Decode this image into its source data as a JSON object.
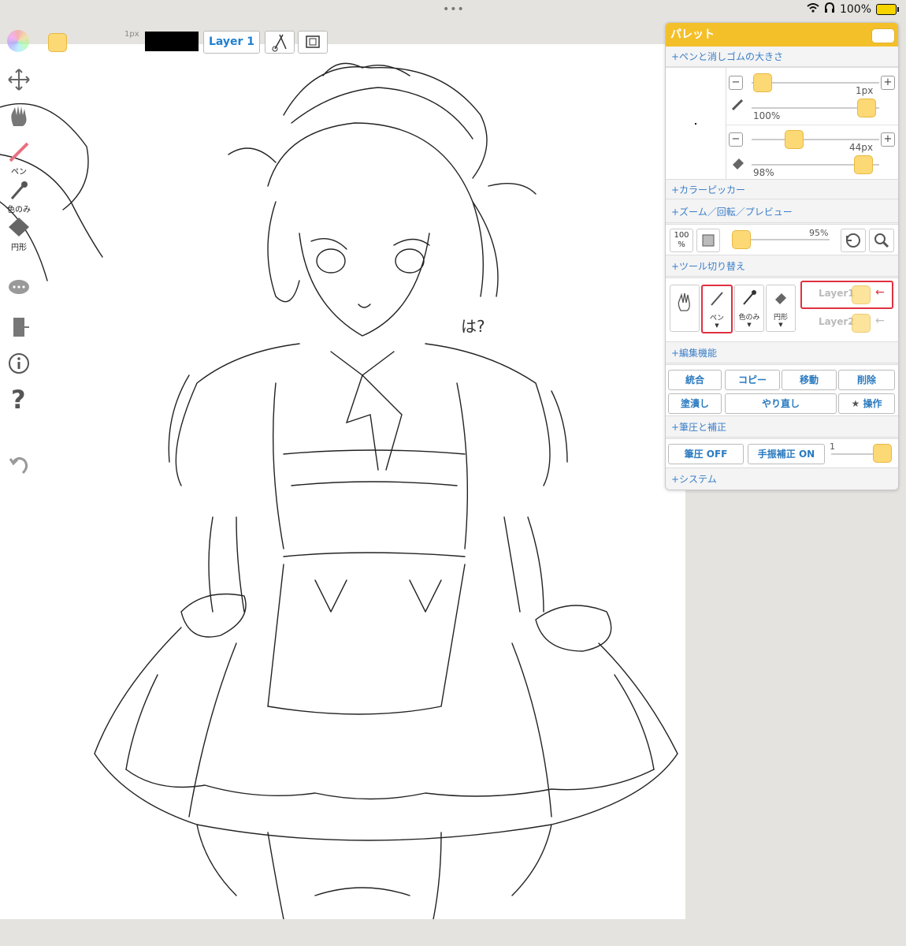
{
  "status": {
    "battery": "100%"
  },
  "toolbar": {
    "size": "1px",
    "layer_button": "Layer 1"
  },
  "left_tools": {
    "pen": "ペン",
    "color_only": "色のみ",
    "shape": "円形"
  },
  "palette": {
    "title": "パレット",
    "sections": {
      "pen_eraser_size": "+ペンと消しゴムの大きさ",
      "color_picker": "+カラーピッカー",
      "zoom": "+ズーム／回転／プレビュー",
      "tool_switch": "+ツール切り替え",
      "edit": "+編集機能",
      "pressure": "+筆圧と補正",
      "system": "+システム"
    },
    "pen": {
      "size": "1px",
      "opacity": "100%"
    },
    "eraser": {
      "size": "44px",
      "opacity": "98%"
    },
    "zoom": {
      "level_label": "100",
      "level_unit": "%",
      "value": "95%"
    },
    "tools": {
      "pen": "ペン",
      "color_only": "色のみ",
      "shape": "円形"
    },
    "layers": {
      "layer1": "Layer1",
      "layer2": "Layer2"
    },
    "edit_buttons": {
      "merge": "統合",
      "copy": "コピー",
      "move": "移動",
      "delete": "削除",
      "fill": "塗潰し",
      "redo": "やり直し",
      "operate": "操作"
    },
    "pressure": {
      "pressure_btn": "筆圧 OFF",
      "stabilizer_btn": "手振補正 ON",
      "stabilizer_value": "1"
    }
  },
  "canvas": {
    "note": "は?"
  }
}
